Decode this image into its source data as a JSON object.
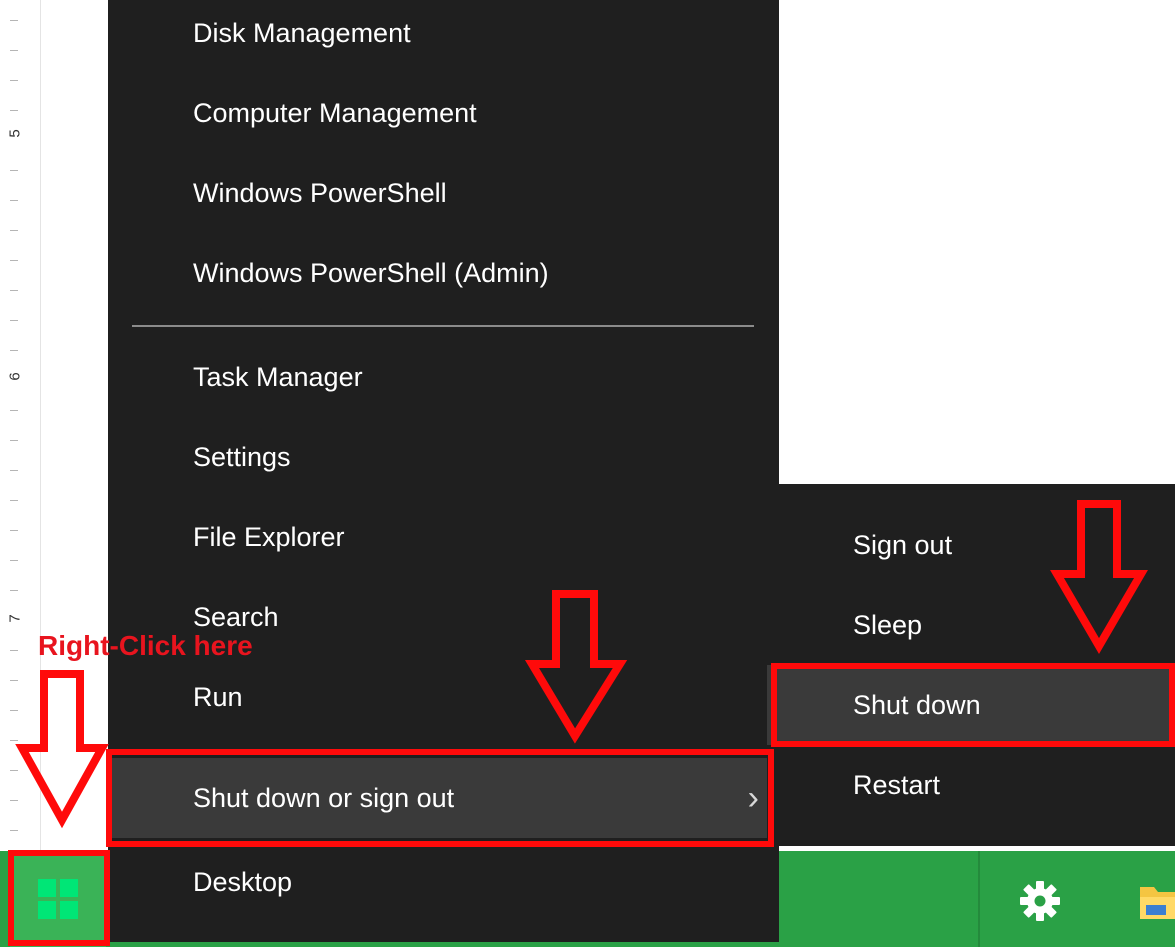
{
  "ruler": {
    "labels": [
      "5",
      "6",
      "7"
    ]
  },
  "context_menu": {
    "items": [
      {
        "label": "Disk Management"
      },
      {
        "label": "Computer Management"
      },
      {
        "label": "Windows PowerShell"
      },
      {
        "label": "Windows PowerShell (Admin)"
      },
      {
        "label": "Task Manager"
      },
      {
        "label": "Settings"
      },
      {
        "label": "File Explorer"
      },
      {
        "label": "Search"
      },
      {
        "label": "Run"
      },
      {
        "label": "Shut down or sign out",
        "chevron": "›"
      },
      {
        "label": "Desktop"
      }
    ]
  },
  "submenu": {
    "items": [
      {
        "label": "Sign out"
      },
      {
        "label": "Sleep"
      },
      {
        "label": "Shut down"
      },
      {
        "label": "Restart"
      }
    ]
  },
  "annotation": {
    "text": "Right-Click here"
  },
  "taskbar": {
    "icons": [
      "windows-logo-icon",
      "gear-icon",
      "folder-icon"
    ]
  },
  "colors": {
    "menu_bg": "#1f1f1f",
    "highlight_bg": "#3a3a3a",
    "taskbar_green": "#2aa146",
    "annotation_red": "#ff0a0a"
  }
}
